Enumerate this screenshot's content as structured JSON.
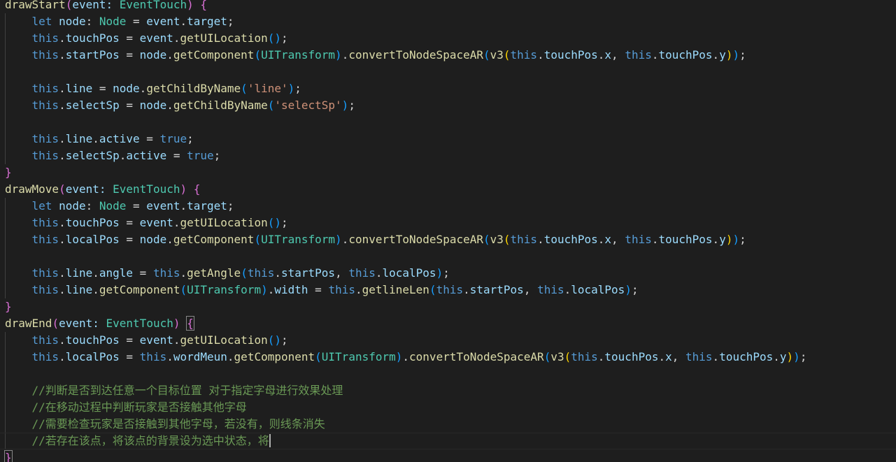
{
  "editor": {
    "theme_colors": {
      "background": "#1e1e1e",
      "function": "#dcdcaa",
      "keyword": "#569cd6",
      "variable": "#9cdcfe",
      "type": "#4ec9b0",
      "string": "#ce9178",
      "comment": "#6a9955",
      "bracket_1": "#da70d6",
      "bracket_2": "#179fff",
      "bracket_3": "#ffd700"
    },
    "cursor_line": 26,
    "lines": [
      [
        {
          "t": "drawStart",
          "c": "fn"
        },
        {
          "t": "(",
          "c": "b1"
        },
        {
          "t": "event: ",
          "c": "var"
        },
        {
          "t": "EventTouch",
          "c": "type"
        },
        {
          "t": ") ",
          "c": "b1"
        },
        {
          "t": "{",
          "c": "b1"
        }
      ],
      [
        {
          "t": "    let ",
          "c": "kw"
        },
        {
          "t": "node",
          "c": "var"
        },
        {
          "t": ": ",
          "c": "punc"
        },
        {
          "t": "Node",
          "c": "type"
        },
        {
          "t": " = ",
          "c": "punc"
        },
        {
          "t": "event",
          "c": "var"
        },
        {
          "t": ".",
          "c": "punc"
        },
        {
          "t": "target",
          "c": "var"
        },
        {
          "t": ";",
          "c": "punc"
        }
      ],
      [
        {
          "t": "    this",
          "c": "kw"
        },
        {
          "t": ".",
          "c": "punc"
        },
        {
          "t": "touchPos",
          "c": "var"
        },
        {
          "t": " = ",
          "c": "punc"
        },
        {
          "t": "event",
          "c": "var"
        },
        {
          "t": ".",
          "c": "punc"
        },
        {
          "t": "getUILocation",
          "c": "fn"
        },
        {
          "t": "()",
          "c": "b2"
        },
        {
          "t": ";",
          "c": "punc"
        }
      ],
      [
        {
          "t": "    this",
          "c": "kw"
        },
        {
          "t": ".",
          "c": "punc"
        },
        {
          "t": "startPos",
          "c": "var"
        },
        {
          "t": " = ",
          "c": "punc"
        },
        {
          "t": "node",
          "c": "var"
        },
        {
          "t": ".",
          "c": "punc"
        },
        {
          "t": "getComponent",
          "c": "fn"
        },
        {
          "t": "(",
          "c": "b2"
        },
        {
          "t": "UITransform",
          "c": "type"
        },
        {
          "t": ")",
          "c": "b2"
        },
        {
          "t": ".",
          "c": "punc"
        },
        {
          "t": "convertToNodeSpaceAR",
          "c": "fn"
        },
        {
          "t": "(",
          "c": "b2"
        },
        {
          "t": "v3",
          "c": "fn"
        },
        {
          "t": "(",
          "c": "b3"
        },
        {
          "t": "this",
          "c": "kw"
        },
        {
          "t": ".",
          "c": "punc"
        },
        {
          "t": "touchPos",
          "c": "var"
        },
        {
          "t": ".",
          "c": "punc"
        },
        {
          "t": "x",
          "c": "var"
        },
        {
          "t": ", ",
          "c": "punc"
        },
        {
          "t": "this",
          "c": "kw"
        },
        {
          "t": ".",
          "c": "punc"
        },
        {
          "t": "touchPos",
          "c": "var"
        },
        {
          "t": ".",
          "c": "punc"
        },
        {
          "t": "y",
          "c": "var"
        },
        {
          "t": ")",
          "c": "b3"
        },
        {
          "t": ")",
          "c": "b2"
        },
        {
          "t": ";",
          "c": "punc"
        }
      ],
      [],
      [
        {
          "t": "    this",
          "c": "kw"
        },
        {
          "t": ".",
          "c": "punc"
        },
        {
          "t": "line",
          "c": "var"
        },
        {
          "t": " = ",
          "c": "punc"
        },
        {
          "t": "node",
          "c": "var"
        },
        {
          "t": ".",
          "c": "punc"
        },
        {
          "t": "getChildByName",
          "c": "fn"
        },
        {
          "t": "(",
          "c": "b2"
        },
        {
          "t": "'line'",
          "c": "str"
        },
        {
          "t": ")",
          "c": "b2"
        },
        {
          "t": ";",
          "c": "punc"
        }
      ],
      [
        {
          "t": "    this",
          "c": "kw"
        },
        {
          "t": ".",
          "c": "punc"
        },
        {
          "t": "selectSp",
          "c": "var"
        },
        {
          "t": " = ",
          "c": "punc"
        },
        {
          "t": "node",
          "c": "var"
        },
        {
          "t": ".",
          "c": "punc"
        },
        {
          "t": "getChildByName",
          "c": "fn"
        },
        {
          "t": "(",
          "c": "b2"
        },
        {
          "t": "'selectSp'",
          "c": "str"
        },
        {
          "t": ")",
          "c": "b2"
        },
        {
          "t": ";",
          "c": "punc"
        }
      ],
      [],
      [
        {
          "t": "    this",
          "c": "kw"
        },
        {
          "t": ".",
          "c": "punc"
        },
        {
          "t": "line",
          "c": "var"
        },
        {
          "t": ".",
          "c": "punc"
        },
        {
          "t": "active",
          "c": "var"
        },
        {
          "t": " = ",
          "c": "punc"
        },
        {
          "t": "true",
          "c": "kw"
        },
        {
          "t": ";",
          "c": "punc"
        }
      ],
      [
        {
          "t": "    this",
          "c": "kw"
        },
        {
          "t": ".",
          "c": "punc"
        },
        {
          "t": "selectSp",
          "c": "var"
        },
        {
          "t": ".",
          "c": "punc"
        },
        {
          "t": "active",
          "c": "var"
        },
        {
          "t": " = ",
          "c": "punc"
        },
        {
          "t": "true",
          "c": "kw"
        },
        {
          "t": ";",
          "c": "punc"
        }
      ],
      [
        {
          "t": "}",
          "c": "b1"
        }
      ],
      [
        {
          "t": "drawMove",
          "c": "fn"
        },
        {
          "t": "(",
          "c": "b1"
        },
        {
          "t": "event: ",
          "c": "var"
        },
        {
          "t": "EventTouch",
          "c": "type"
        },
        {
          "t": ") ",
          "c": "b1"
        },
        {
          "t": "{",
          "c": "b1"
        }
      ],
      [
        {
          "t": "    let ",
          "c": "kw"
        },
        {
          "t": "node",
          "c": "var"
        },
        {
          "t": ": ",
          "c": "punc"
        },
        {
          "t": "Node",
          "c": "type"
        },
        {
          "t": " = ",
          "c": "punc"
        },
        {
          "t": "event",
          "c": "var"
        },
        {
          "t": ".",
          "c": "punc"
        },
        {
          "t": "target",
          "c": "var"
        },
        {
          "t": ";",
          "c": "punc"
        }
      ],
      [
        {
          "t": "    this",
          "c": "kw"
        },
        {
          "t": ".",
          "c": "punc"
        },
        {
          "t": "touchPos",
          "c": "var"
        },
        {
          "t": " = ",
          "c": "punc"
        },
        {
          "t": "event",
          "c": "var"
        },
        {
          "t": ".",
          "c": "punc"
        },
        {
          "t": "getUILocation",
          "c": "fn"
        },
        {
          "t": "()",
          "c": "b2"
        },
        {
          "t": ";",
          "c": "punc"
        }
      ],
      [
        {
          "t": "    this",
          "c": "kw"
        },
        {
          "t": ".",
          "c": "punc"
        },
        {
          "t": "localPos",
          "c": "var"
        },
        {
          "t": " = ",
          "c": "punc"
        },
        {
          "t": "node",
          "c": "var"
        },
        {
          "t": ".",
          "c": "punc"
        },
        {
          "t": "getComponent",
          "c": "fn"
        },
        {
          "t": "(",
          "c": "b2"
        },
        {
          "t": "UITransform",
          "c": "type"
        },
        {
          "t": ")",
          "c": "b2"
        },
        {
          "t": ".",
          "c": "punc"
        },
        {
          "t": "convertToNodeSpaceAR",
          "c": "fn"
        },
        {
          "t": "(",
          "c": "b2"
        },
        {
          "t": "v3",
          "c": "fn"
        },
        {
          "t": "(",
          "c": "b3"
        },
        {
          "t": "this",
          "c": "kw"
        },
        {
          "t": ".",
          "c": "punc"
        },
        {
          "t": "touchPos",
          "c": "var"
        },
        {
          "t": ".",
          "c": "punc"
        },
        {
          "t": "x",
          "c": "var"
        },
        {
          "t": ", ",
          "c": "punc"
        },
        {
          "t": "this",
          "c": "kw"
        },
        {
          "t": ".",
          "c": "punc"
        },
        {
          "t": "touchPos",
          "c": "var"
        },
        {
          "t": ".",
          "c": "punc"
        },
        {
          "t": "y",
          "c": "var"
        },
        {
          "t": ")",
          "c": "b3"
        },
        {
          "t": ")",
          "c": "b2"
        },
        {
          "t": ";",
          "c": "punc"
        }
      ],
      [],
      [
        {
          "t": "    this",
          "c": "kw"
        },
        {
          "t": ".",
          "c": "punc"
        },
        {
          "t": "line",
          "c": "var"
        },
        {
          "t": ".",
          "c": "punc"
        },
        {
          "t": "angle",
          "c": "var"
        },
        {
          "t": " = ",
          "c": "punc"
        },
        {
          "t": "this",
          "c": "kw"
        },
        {
          "t": ".",
          "c": "punc"
        },
        {
          "t": "getAngle",
          "c": "fn"
        },
        {
          "t": "(",
          "c": "b2"
        },
        {
          "t": "this",
          "c": "kw"
        },
        {
          "t": ".",
          "c": "punc"
        },
        {
          "t": "startPos",
          "c": "var"
        },
        {
          "t": ", ",
          "c": "punc"
        },
        {
          "t": "this",
          "c": "kw"
        },
        {
          "t": ".",
          "c": "punc"
        },
        {
          "t": "localPos",
          "c": "var"
        },
        {
          "t": ")",
          "c": "b2"
        },
        {
          "t": ";",
          "c": "punc"
        }
      ],
      [
        {
          "t": "    this",
          "c": "kw"
        },
        {
          "t": ".",
          "c": "punc"
        },
        {
          "t": "line",
          "c": "var"
        },
        {
          "t": ".",
          "c": "punc"
        },
        {
          "t": "getComponent",
          "c": "fn"
        },
        {
          "t": "(",
          "c": "b2"
        },
        {
          "t": "UITransform",
          "c": "type"
        },
        {
          "t": ")",
          "c": "b2"
        },
        {
          "t": ".",
          "c": "punc"
        },
        {
          "t": "width",
          "c": "var"
        },
        {
          "t": " = ",
          "c": "punc"
        },
        {
          "t": "this",
          "c": "kw"
        },
        {
          "t": ".",
          "c": "punc"
        },
        {
          "t": "getlineLen",
          "c": "fn"
        },
        {
          "t": "(",
          "c": "b2"
        },
        {
          "t": "this",
          "c": "kw"
        },
        {
          "t": ".",
          "c": "punc"
        },
        {
          "t": "startPos",
          "c": "var"
        },
        {
          "t": ", ",
          "c": "punc"
        },
        {
          "t": "this",
          "c": "kw"
        },
        {
          "t": ".",
          "c": "punc"
        },
        {
          "t": "localPos",
          "c": "var"
        },
        {
          "t": ")",
          "c": "b2"
        },
        {
          "t": ";",
          "c": "punc"
        }
      ],
      [
        {
          "t": "}",
          "c": "b1"
        }
      ],
      [
        {
          "t": "drawEnd",
          "c": "fn"
        },
        {
          "t": "(",
          "c": "b1"
        },
        {
          "t": "event: ",
          "c": "var"
        },
        {
          "t": "EventTouch",
          "c": "type"
        },
        {
          "t": ") ",
          "c": "b1"
        },
        {
          "t": "{",
          "c": "b1",
          "m": true
        }
      ],
      [
        {
          "t": "    this",
          "c": "kw"
        },
        {
          "t": ".",
          "c": "punc"
        },
        {
          "t": "touchPos",
          "c": "var"
        },
        {
          "t": " = ",
          "c": "punc"
        },
        {
          "t": "event",
          "c": "var"
        },
        {
          "t": ".",
          "c": "punc"
        },
        {
          "t": "getUILocation",
          "c": "fn"
        },
        {
          "t": "()",
          "c": "b2"
        },
        {
          "t": ";",
          "c": "punc"
        }
      ],
      [
        {
          "t": "    this",
          "c": "kw"
        },
        {
          "t": ".",
          "c": "punc"
        },
        {
          "t": "localPos",
          "c": "var"
        },
        {
          "t": " = ",
          "c": "punc"
        },
        {
          "t": "this",
          "c": "kw"
        },
        {
          "t": ".",
          "c": "punc"
        },
        {
          "t": "wordMeun",
          "c": "var"
        },
        {
          "t": ".",
          "c": "punc"
        },
        {
          "t": "getComponent",
          "c": "fn"
        },
        {
          "t": "(",
          "c": "b2"
        },
        {
          "t": "UITransform",
          "c": "type"
        },
        {
          "t": ")",
          "c": "b2"
        },
        {
          "t": ".",
          "c": "punc"
        },
        {
          "t": "convertToNodeSpaceAR",
          "c": "fn"
        },
        {
          "t": "(",
          "c": "b2"
        },
        {
          "t": "v3",
          "c": "fn"
        },
        {
          "t": "(",
          "c": "b3"
        },
        {
          "t": "this",
          "c": "kw"
        },
        {
          "t": ".",
          "c": "punc"
        },
        {
          "t": "touchPos",
          "c": "var"
        },
        {
          "t": ".",
          "c": "punc"
        },
        {
          "t": "x",
          "c": "var"
        },
        {
          "t": ", ",
          "c": "punc"
        },
        {
          "t": "this",
          "c": "kw"
        },
        {
          "t": ".",
          "c": "punc"
        },
        {
          "t": "touchPos",
          "c": "var"
        },
        {
          "t": ".",
          "c": "punc"
        },
        {
          "t": "y",
          "c": "var"
        },
        {
          "t": ")",
          "c": "b3"
        },
        {
          "t": ")",
          "c": "b2"
        },
        {
          "t": ";",
          "c": "punc"
        }
      ],
      [],
      [
        {
          "t": "    //判断是否到达任意一个目标位置 对于指定字母进行效果处理",
          "c": "cmt"
        }
      ],
      [
        {
          "t": "    //在移动过程中判断玩家是否接触其他字母",
          "c": "cmt"
        }
      ],
      [
        {
          "t": "    //需要检查玩家是否接触到其他字母，若没有，则线条消失",
          "c": "cmt"
        }
      ],
      [
        {
          "t": "    //若存在该点，将该点的背景设为选中状态，将",
          "c": "cmt"
        }
      ],
      [
        {
          "t": "}",
          "c": "b1",
          "m": true
        }
      ]
    ]
  }
}
